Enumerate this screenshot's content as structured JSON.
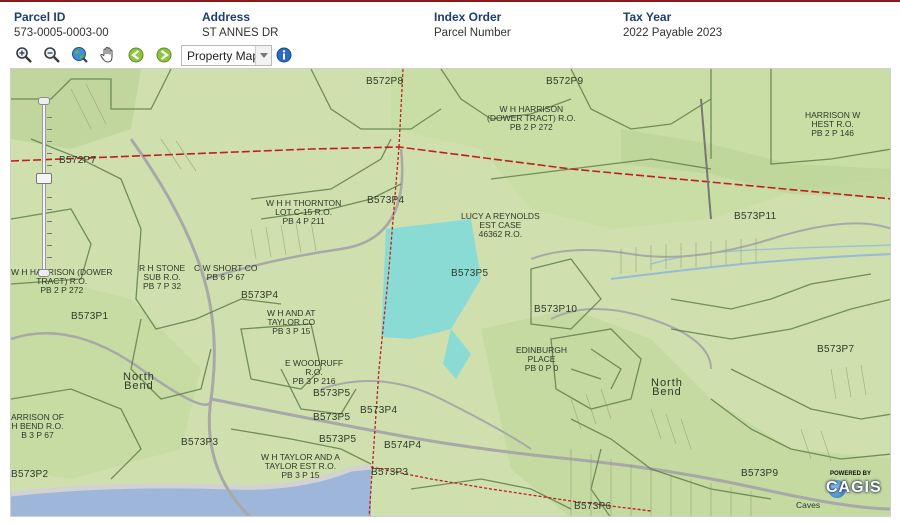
{
  "header": {
    "fields": [
      {
        "label": "Parcel ID",
        "value": "573-0005-0003-00"
      },
      {
        "label": "Address",
        "value": "ST ANNES DR"
      },
      {
        "label": "Index Order",
        "value": "Parcel Number"
      },
      {
        "label": "Tax Year",
        "value": "2022 Payable 2023"
      }
    ]
  },
  "toolbar": {
    "tools": [
      "zoom-in-icon",
      "zoom-out-icon",
      "globe-icon",
      "pan-hand-icon",
      "back-arrow-icon",
      "forward-arrow-icon",
      "info-icon"
    ],
    "layer_select_value": "Property Map"
  },
  "map": {
    "labels": {
      "b572p8": "B572P8",
      "b572p9": "B572P9",
      "b572p7": "B572P7",
      "harrison_dower": "W H HARRISON\n(DOWER TRACT) R.O.\nPB 2 P 272",
      "harrison_west": "HARRISON W\nHEST R.O.\nPB 2 P 146",
      "thornton": "W H H THORNTON\nLOT C-15 R.O.\nPB 4 P 211",
      "b573p4_a": "B573P4",
      "reynolds": "LUCY A REYNOLDS\nEST CASE\n46362 R.O.",
      "b573p11": "B573P11",
      "harrison_dower_left": "W H HARRISON (DOWER\nTRACT) R.O.\nPB 2 P 272",
      "rh_stone": "R H STONE\nSUB R.O.\nPB 7 P 32",
      "cw_short": "C W SHORT CO\nPB 6 P 67",
      "b573p4_b": "B573P4",
      "b573p5_a": "B573P5",
      "b573p1": "B573P1",
      "wh_taylor_co": "W H AND AT\nTAYLOR CO\nPB 3 P 15",
      "b573p10": "B573P10",
      "edinburgh": "EDINBURGH\nPLACE\nPB 0 P 0",
      "b573p7": "B573P7",
      "north_bend_left": "North\nBend",
      "woodruff": "E WOODRUFF\nR.O.\nPB 3 P 216",
      "b573p5_b": "B573P5",
      "b573p5_c": "B573P5",
      "b573p4_c": "B573P4",
      "north_bend_right": "North\nBend",
      "harrison_of": "ARRISON OF\nH BEND R.O.\nB 3 P 67",
      "b573p5_d": "B573P5",
      "b574p4": "B574P4",
      "b573p3_a": "B573P3",
      "taylor_est": "W H TAYLOR AND A\nTAYLOR EST R.O.\nPB 3 P 15",
      "b573p3_b": "B573P3",
      "b573p9": "B573P9",
      "b573p2": "B573P2",
      "b573p6": "B573P6",
      "caves": "Caves"
    },
    "logo": {
      "powered_by": "POWERED BY",
      "name": "CAGIS"
    }
  }
}
